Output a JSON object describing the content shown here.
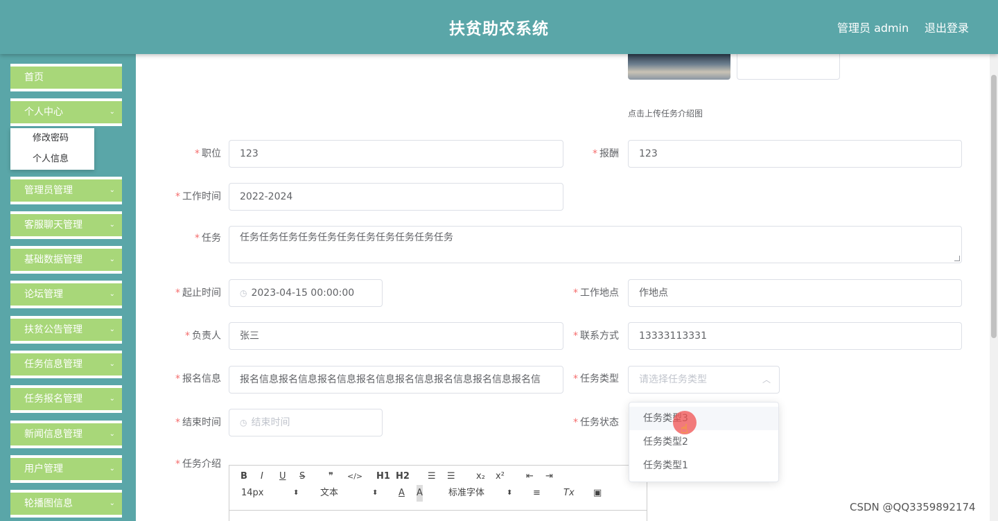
{
  "header": {
    "title": "扶贫助农系统",
    "admin_label": "管理员 admin",
    "logout_label": "退出登录"
  },
  "sidebar": {
    "items": [
      {
        "label": "首页",
        "has_children": false
      },
      {
        "label": "个人中心",
        "has_children": true
      },
      {
        "label": "管理员管理",
        "has_children": true
      },
      {
        "label": "客服聊天管理",
        "has_children": true
      },
      {
        "label": "基础数据管理",
        "has_children": true
      },
      {
        "label": "论坛管理",
        "has_children": true
      },
      {
        "label": "扶贫公告管理",
        "has_children": true
      },
      {
        "label": "任务信息管理",
        "has_children": true
      },
      {
        "label": "任务报名管理",
        "has_children": true
      },
      {
        "label": "新闻信息管理",
        "has_children": true
      },
      {
        "label": "用户管理",
        "has_children": true
      },
      {
        "label": "轮播图信息",
        "has_children": true
      }
    ],
    "submenu": [
      "修改密码",
      "个人信息"
    ]
  },
  "form": {
    "upload_hint": "点击上传任务介绍图",
    "position": {
      "label": "职位",
      "value": "123"
    },
    "salary": {
      "label": "报酬",
      "value": "123"
    },
    "work_time": {
      "label": "工作时间",
      "value": "2022-2024"
    },
    "task": {
      "label": "任务",
      "value": "任务任务任务任务任务任务任务任务任务任务任务"
    },
    "start_end_time": {
      "label": "起止时间",
      "value": "2023-04-15 00:00:00"
    },
    "work_location": {
      "label": "工作地点",
      "value": "作地点"
    },
    "person_in_charge": {
      "label": "负责人",
      "value": "张三"
    },
    "contact": {
      "label": "联系方式",
      "value": "13333113331"
    },
    "signup_info": {
      "label": "报名信息",
      "value": "报名信息报名信息报名信息报名信息报名信息报名信息报名信息报名信"
    },
    "task_type": {
      "label": "任务类型",
      "placeholder": "请选择任务类型"
    },
    "end_time": {
      "label": "结束时间",
      "placeholder": "结束时间"
    },
    "task_status": {
      "label": "任务状态"
    },
    "task_intro": {
      "label": "任务介绍"
    }
  },
  "dropdown": {
    "options": [
      "任务类型3",
      "任务类型2",
      "任务类型1"
    ]
  },
  "editor_toolbar": {
    "bold": "B",
    "italic": "I",
    "underline": "U",
    "strike": "S",
    "quote": "❞",
    "code": "</>",
    "h1": "H1",
    "h2": "H2",
    "ordered_list": "☰",
    "bullet_list": "☰",
    "sub": "x₂",
    "sup": "x²",
    "indent_dec": "⇤",
    "indent_inc": "⇥",
    "font_size": "14px",
    "text_type": "文本",
    "font_family": "标准字体",
    "font_color": "A",
    "bg_color": "A",
    "align": "≡",
    "clear": "Tx",
    "image": "▣"
  },
  "watermark": "CSDN @QQ3359892174",
  "colors": {
    "header_bg": "#5aa6a8",
    "menu_bg": "#a8d779",
    "required": "#f56c6c"
  }
}
